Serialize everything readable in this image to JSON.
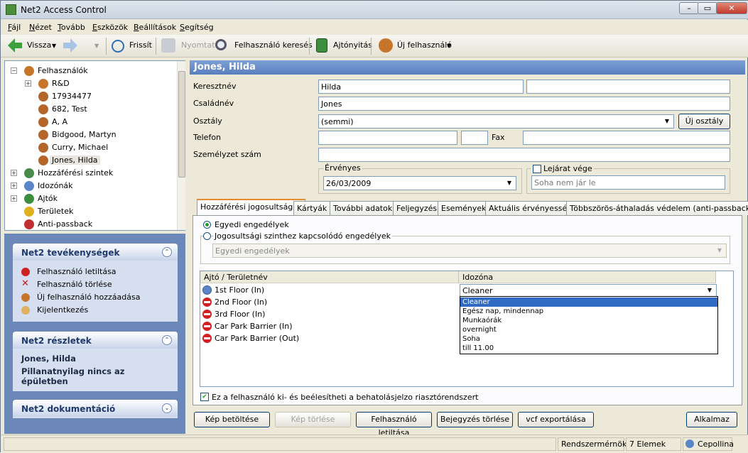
{
  "window": {
    "title": "Net2 Access Control",
    "min": "–",
    "max": "▭",
    "close": "✕"
  },
  "menu": [
    {
      "key": "F",
      "rest": "ájl"
    },
    {
      "key": "N",
      "rest": "ézet"
    },
    {
      "key": "T",
      "rest": "ovább"
    },
    {
      "key": "E",
      "rest": "szközök"
    },
    {
      "key": "B",
      "rest": "eállítások"
    },
    {
      "key": "S",
      "rest": "egítség"
    }
  ],
  "toolbar": {
    "back": "Vissza",
    "refresh": "Frissít",
    "print": "Nyomtat",
    "search": "Felhasználó keresés",
    "door_open": "Ajtónyitás",
    "new_user": "Új felhasználó"
  },
  "tree": [
    {
      "label": "Felhasználók",
      "level": 0,
      "exp": "−"
    },
    {
      "label": "R&D",
      "level": 1,
      "exp": "+"
    },
    {
      "label": "17934477",
      "level": 1
    },
    {
      "label": "682, Test",
      "level": 1
    },
    {
      "label": "A, A",
      "level": 1
    },
    {
      "label": "Bidgood, Martyn",
      "level": 1
    },
    {
      "label": "Curry, Michael",
      "level": 1
    },
    {
      "label": "Jones, Hilda",
      "level": 1,
      "selected": true
    },
    {
      "label": "Hozzáférési szintek",
      "level": 0,
      "exp": "+"
    },
    {
      "label": "Idozónák",
      "level": 0,
      "exp": "+"
    },
    {
      "label": "Ajtók",
      "level": 0,
      "exp": "+"
    },
    {
      "label": "Területek",
      "level": 0
    },
    {
      "label": "Anti-passback",
      "level": 0
    }
  ],
  "panels": {
    "activities": {
      "title": "Net2 tevékenységek",
      "items": [
        "Felhasználó letiltása",
        "Felhasználó törlése",
        "Új felhasználó hozzáadása",
        "Kijelentkezés"
      ]
    },
    "details": {
      "title": "Net2 részletek",
      "name": "Jones, Hilda",
      "status": "Pillanatnyilag nincs az épületben"
    },
    "docs": {
      "title": "Net2 dokumentáció"
    }
  },
  "user": {
    "header": "Jones, Hilda",
    "first_name_label": "Keresztnév",
    "first_name": "Hilda",
    "last_name_label": "Családnév",
    "last_name": "Jones",
    "dept_label": "Osztály",
    "dept": "(semmi)",
    "new_dept": "Új osztály",
    "phone_label": "Telefon",
    "fax_label": "Fax",
    "staff_label": "Személyzet szám",
    "valid_label": "Érvényes",
    "valid_date": "26/03/2009",
    "expiry_label": "Lejárat vége",
    "expiry_placeholder": "Soha nem jár le"
  },
  "tabs": [
    "Hozzáférési jogosultságok",
    "Kártyák",
    "További adatok",
    "Feljegyzés",
    "Események",
    "Aktuális érvényesség",
    "Többszörös-áthaladás védelem (anti-passback)"
  ],
  "access": {
    "radio1": "Egyedi engedélyek",
    "radio2": "Jogosultsági szinthez kapcsolódó engedélyek",
    "level_select": "Egyedi engedélyek",
    "col_door": "Ajtó / Területnév",
    "col_tz": "Idozóna",
    "rows": [
      "1st Floor (In)",
      "2nd Floor (In)",
      "3rd Floor (In)",
      "Car Park Barrier (In)",
      "Car Park Barrier (Out)"
    ],
    "tz_value": "Cleaner",
    "tz_options": [
      "Cleaner",
      "Egész nap, mindennap",
      "Munkaórák",
      "overnight",
      "Soha",
      "till 11.00"
    ],
    "alarm_check": "Ez a felhasználó ki- és beélesítheti a behatolásjelzo riasztórendszert"
  },
  "buttons": {
    "load_img": "Kép betöltése",
    "del_img": "Kép törlése",
    "block": "Felhasználó letiltása",
    "del_entry": "Bejegyzés törlése",
    "vcf": "vcf exportálása",
    "apply": "Alkalmaz"
  },
  "status": {
    "role": "Rendszermérnök",
    "count": "7 Elemek",
    "site": "Cepollina"
  }
}
